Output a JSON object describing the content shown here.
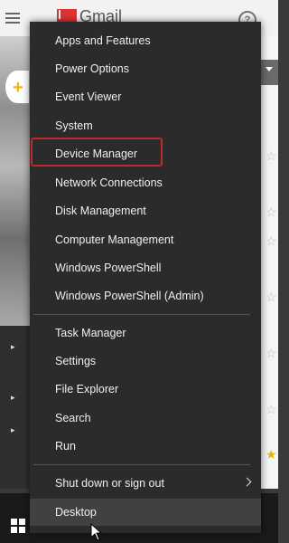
{
  "background": {
    "app_title": "Gmail",
    "help_icon": "question-icon",
    "compose_icon": "plus-icon"
  },
  "menu": {
    "groups": [
      [
        {
          "label": "Apps and Features"
        },
        {
          "label": "Power Options"
        },
        {
          "label": "Event Viewer"
        },
        {
          "label": "System"
        },
        {
          "label": "Device Manager",
          "highlighted": true
        },
        {
          "label": "Network Connections"
        },
        {
          "label": "Disk Management"
        },
        {
          "label": "Computer Management"
        },
        {
          "label": "Windows PowerShell"
        },
        {
          "label": "Windows PowerShell (Admin)"
        }
      ],
      [
        {
          "label": "Task Manager"
        },
        {
          "label": "Settings"
        },
        {
          "label": "File Explorer"
        },
        {
          "label": "Search"
        },
        {
          "label": "Run"
        }
      ],
      [
        {
          "label": "Shut down or sign out",
          "submenu": true
        },
        {
          "label": "Desktop",
          "hovered": true
        }
      ]
    ],
    "highlight_color": "#c0282d",
    "background_color": "#2b2b2b"
  },
  "taskbar": {
    "start_icon": "windows-logo-icon"
  }
}
